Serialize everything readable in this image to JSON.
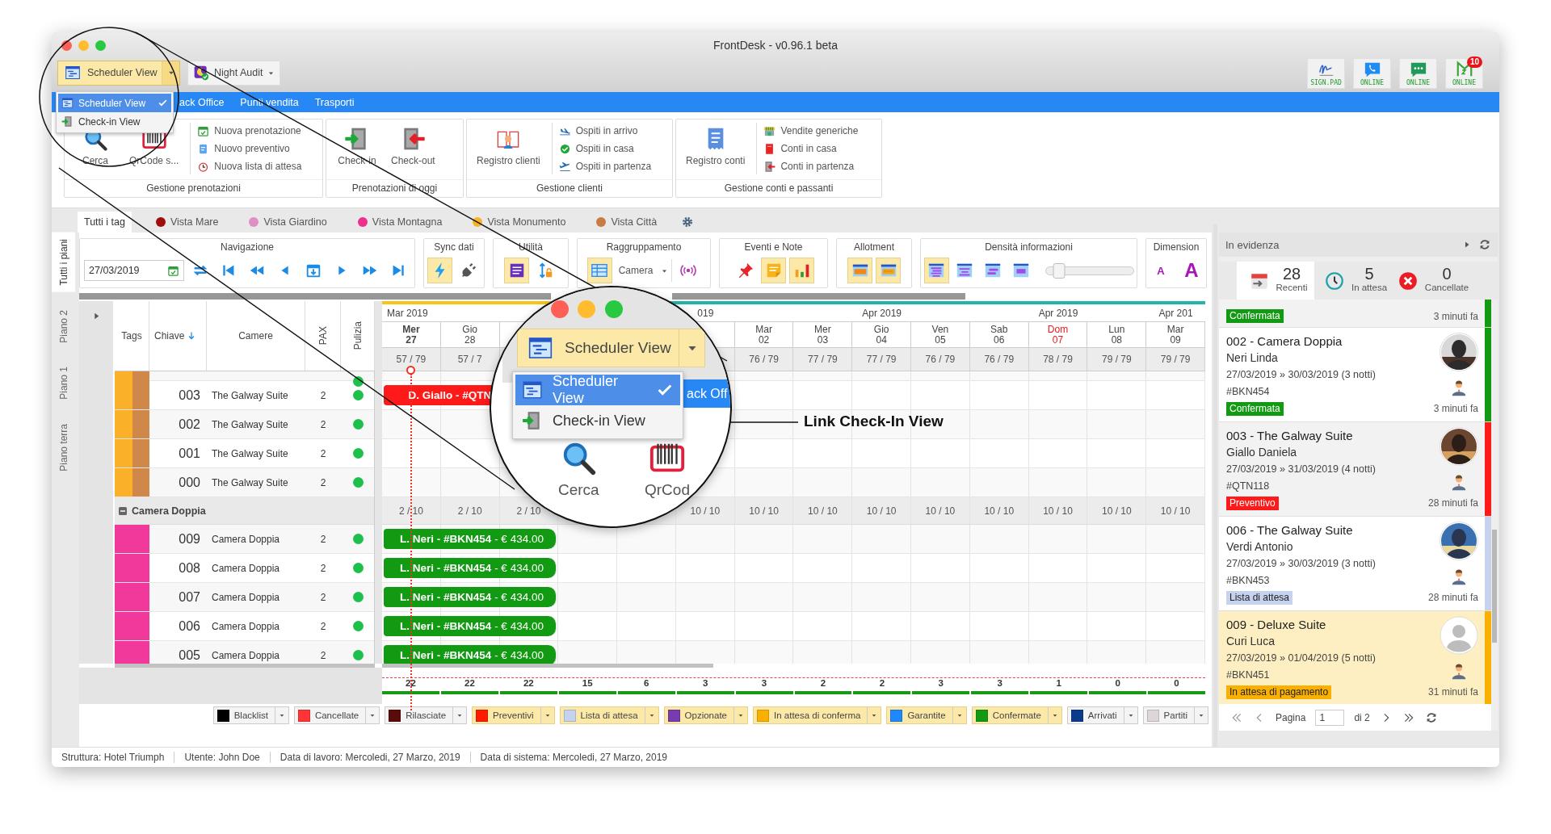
{
  "window": {
    "title": "FrontDesk - v0.96.1 beta"
  },
  "view_switcher": {
    "label": "Scheduler View",
    "expanded": true,
    "menu": [
      {
        "label": "Scheduler View",
        "selected": true
      },
      {
        "label": "Check-in View",
        "selected": false
      }
    ]
  },
  "night_audit": {
    "label": "Night Audit"
  },
  "devices": [
    {
      "label": "SIGN.PAD"
    },
    {
      "label": "ONLINE"
    },
    {
      "label": "ONLINE"
    },
    {
      "label": "ONLINE",
      "badge": "10"
    }
  ],
  "menu_bar": [
    "ack Office",
    "Punti vendita",
    "Trasporti"
  ],
  "ribbon": [
    {
      "title": "Gestione prenotazioni",
      "large": [
        "Cerca",
        "QrCode s..."
      ],
      "small": [
        "Nuova prenotazione",
        "Nuovo preventivo",
        "Nuova lista di attesa"
      ]
    },
    {
      "title": "Prenotazioni di oggi",
      "large": [
        "Check-in",
        "Check-out"
      ]
    },
    {
      "title": "Gestione clienti",
      "large": [
        "Registro clienti"
      ],
      "small": [
        "Ospiti in arrivo",
        "Ospiti in casa",
        "Ospiti in partenza"
      ]
    },
    {
      "title": "Gestione conti e passanti",
      "large": [
        "Registro conti"
      ],
      "small": [
        "Vendite generiche",
        "Conti in casa",
        "Conti in partenza"
      ]
    }
  ],
  "tag_filters": [
    {
      "label": "Tutti i tag",
      "selected": true
    },
    {
      "label": "Vista Mare",
      "color": "#a00d0d",
      "selected": false
    },
    {
      "label": "Vista Giardino",
      "color": "#e08fc4",
      "selected": false
    },
    {
      "label": "Vista Montagna",
      "color": "#ee2f8c",
      "selected": false
    },
    {
      "label": "Vista Monumento",
      "color": "#f7b324",
      "selected": false
    },
    {
      "label": "Vista Città",
      "color": "#c97b44",
      "selected": false
    }
  ],
  "floor_tabs": [
    {
      "label": "Tutti i piani",
      "selected": true
    },
    {
      "label": "Piano 2",
      "selected": false
    },
    {
      "label": "Piano 1",
      "selected": false
    },
    {
      "label": "Piano terra",
      "selected": false
    }
  ],
  "toolbar": [
    {
      "title": "Navigazione",
      "items": [
        {
          "kind": "date",
          "value": "27/03/2019"
        },
        {
          "kind": "button",
          "active": false
        },
        {
          "kind": "button",
          "active": false
        },
        {
          "kind": "button",
          "active": false
        },
        {
          "kind": "button",
          "active": false
        },
        {
          "kind": "button",
          "active": false
        },
        {
          "kind": "button",
          "active": false
        },
        {
          "kind": "button",
          "active": false
        },
        {
          "kind": "button",
          "active": false
        }
      ]
    },
    {
      "title": "Sync dati",
      "items": [
        {
          "kind": "button",
          "active": true
        },
        {
          "kind": "button",
          "active": false
        }
      ]
    },
    {
      "title": "Utilità",
      "items": [
        {
          "kind": "button",
          "active": true
        },
        {
          "kind": "button",
          "active": false
        }
      ]
    },
    {
      "title": "Raggruppamento",
      "items": [
        {
          "kind": "button",
          "active": true
        },
        {
          "kind": "select",
          "value": "Camera"
        },
        {
          "kind": "button",
          "active": false
        }
      ]
    },
    {
      "title": "Eventi e Note",
      "items": [
        {
          "kind": "button",
          "active": false
        },
        {
          "kind": "button",
          "active": true
        },
        {
          "kind": "button",
          "active": true
        }
      ]
    },
    {
      "title": "Allotment",
      "items": [
        {
          "kind": "button",
          "active": true
        },
        {
          "kind": "button",
          "active": true
        }
      ]
    },
    {
      "title": "Densità informazioni",
      "items": [
        {
          "kind": "button",
          "active": true
        },
        {
          "kind": "button",
          "active": false
        },
        {
          "kind": "button",
          "active": false
        },
        {
          "kind": "button",
          "active": false
        },
        {
          "kind": "slider",
          "level": 0.15
        }
      ]
    },
    {
      "title": "Dimension",
      "items": [
        {
          "kind": "text_button",
          "text": "A"
        },
        {
          "kind": "text_button",
          "text": "A"
        }
      ]
    }
  ],
  "scheduler": {
    "columns": [
      {
        "label": "Tags",
        "sorted": false
      },
      {
        "label": "Chiave",
        "sorted": true
      },
      {
        "label": "Camere",
        "sorted": false
      },
      {
        "label": "PAX",
        "sorted": false
      },
      {
        "label": "Pulizia",
        "sorted": false
      }
    ],
    "days": [
      {
        "kind": "day",
        "month": "Mar 2019",
        "weekday": "Mer",
        "date": "27",
        "avail": "57 / 79",
        "group_avail": "2 / 10",
        "holiday": false,
        "today": true,
        "color": "#f5c518"
      },
      {
        "kind": "day",
        "weekday": "Gio",
        "date": "28",
        "avail": "57 / 7",
        "group_avail": "2 / 10",
        "holiday": false,
        "today": false,
        "color": "#f5c518"
      },
      {
        "kind": "covered",
        "group_avail": "2 / 10",
        "color": "#f5c518"
      },
      {
        "kind": "covered"
      },
      {
        "kind": "covered",
        "color": "#1fb5a8"
      },
      {
        "kind": "covered",
        "month": "019",
        "group_avail": "10 / 10",
        "color": "#1fb5a8"
      },
      {
        "kind": "day",
        "weekday": "Mar",
        "date": "02",
        "avail": "76 / 79",
        "group_avail": "10 / 10",
        "holiday": false,
        "today": false,
        "color": "#1fb5a8"
      },
      {
        "kind": "day",
        "weekday": "Mer",
        "date": "03",
        "avail": "77 / 79",
        "group_avail": "10 / 10",
        "holiday": false,
        "today": false,
        "color": "#1fb5a8"
      },
      {
        "kind": "day",
        "month": "Apr 2019",
        "weekday": "Gio",
        "date": "04",
        "avail": "77 / 79",
        "group_avail": "10 / 10",
        "holiday": false,
        "today": false,
        "color": "#1fb5a8"
      },
      {
        "kind": "day",
        "weekday": "Ven",
        "date": "05",
        "avail": "76 / 79",
        "group_avail": "10 / 10",
        "holiday": false,
        "today": false,
        "color": "#1fb5a8"
      },
      {
        "kind": "day",
        "weekday": "Sab",
        "date": "06",
        "avail": "76 / 79",
        "group_avail": "10 / 10",
        "holiday": false,
        "today": false,
        "color": "#1fb5a8"
      },
      {
        "kind": "day",
        "month": "Apr 2019",
        "weekday": "Dom",
        "date": "07",
        "avail": "78 / 79",
        "group_avail": "10 / 10",
        "holiday": true,
        "today": false,
        "color": "#1fb5a8"
      },
      {
        "kind": "day",
        "weekday": "Lun",
        "date": "08",
        "avail": "79 / 79",
        "group_avail": "10 / 10",
        "holiday": false,
        "today": false,
        "color": "#1fb5a8"
      },
      {
        "kind": "day",
        "month": "Apr 201",
        "weekday": "Mar",
        "date": "09",
        "avail": "79 / 79",
        "group_avail": "10 / 10",
        "holiday": false,
        "today": false,
        "color": "#1fb5a8"
      }
    ],
    "rows": [
      {
        "kind": "partial",
        "tags": [
          {
            "color": "#fbb02a"
          },
          {
            "color": "#d0884a"
          }
        ],
        "clean": true
      },
      {
        "kind": "room",
        "key": "003",
        "name": "The Galway Suite",
        "pax": "2",
        "clean": true,
        "tags": [
          {
            "color": "#fbb02a"
          },
          {
            "color": "#d0884a"
          }
        ],
        "booking": {
          "label": "**D. Giallo - #QTN**",
          "color": "#ff1a1a"
        }
      },
      {
        "kind": "room",
        "key": "002",
        "name": "The Galway Suite",
        "pax": "2",
        "clean": true,
        "tags": [
          {
            "color": "#fbb02a"
          },
          {
            "color": "#d0884a"
          }
        ]
      },
      {
        "kind": "room",
        "key": "001",
        "name": "The Galway Suite",
        "pax": "2",
        "clean": true,
        "tags": [
          {
            "color": "#fbb02a"
          },
          {
            "color": "#d0884a"
          }
        ]
      },
      {
        "kind": "room",
        "key": "000",
        "name": "The Galway Suite",
        "pax": "2",
        "clean": true,
        "tags": [
          {
            "color": "#fbb02a"
          },
          {
            "color": "#d0884a"
          }
        ]
      },
      {
        "kind": "group",
        "label": "Camera Doppia",
        "expanded": true
      },
      {
        "kind": "room",
        "key": "009",
        "name": "Camera Doppia",
        "pax": "2",
        "clean": true,
        "tags": [
          {
            "color": "#f0399a"
          }
        ],
        "booking": {
          "label": "**L. Neri - #BKN454** - € 434.00",
          "color": "#139a13"
        }
      },
      {
        "kind": "room",
        "key": "008",
        "name": "Camera Doppia",
        "pax": "2",
        "clean": true,
        "tags": [
          {
            "color": "#f0399a"
          }
        ],
        "booking": {
          "label": "**L. Neri - #BKN454** - € 434.00",
          "color": "#139a13"
        }
      },
      {
        "kind": "room",
        "key": "007",
        "name": "Camera Doppia",
        "pax": "2",
        "clean": true,
        "tags": [
          {
            "color": "#f0399a"
          }
        ],
        "booking": {
          "label": "**L. Neri - #BKN454** - € 434.00",
          "color": "#139a13"
        }
      },
      {
        "kind": "room",
        "key": "006",
        "name": "Camera Doppia",
        "pax": "2",
        "clean": true,
        "tags": [
          {
            "color": "#f0399a"
          }
        ],
        "booking": {
          "label": "**L. Neri - #BKN454** - € 434.00",
          "color": "#139a13"
        }
      },
      {
        "kind": "room",
        "key": "005",
        "name": "Camera Doppia",
        "pax": "2",
        "clean": true,
        "tags": [
          {
            "color": "#f0399a"
          }
        ],
        "booking": {
          "label": "**L. Neri - #BKN454** - € 434.00",
          "color": "#139a13"
        }
      }
    ],
    "totals": [
      {
        "value": "22"
      },
      {
        "value": "22"
      },
      {
        "value": "22"
      },
      {
        "value": "15"
      },
      {
        "value": "6"
      },
      {
        "value": "3"
      },
      {
        "value": "3"
      },
      {
        "value": "2"
      },
      {
        "value": "2"
      },
      {
        "value": "3"
      },
      {
        "value": "3"
      },
      {
        "value": "1"
      },
      {
        "value": "0"
      },
      {
        "value": "0"
      }
    ]
  },
  "legend": [
    {
      "label": "Blacklist",
      "color": "#000000",
      "active": false
    },
    {
      "label": "Cancellate",
      "color": "#ff3535",
      "active": false
    },
    {
      "label": "Rilasciate",
      "color": "#5c0b0b",
      "active": false
    },
    {
      "label": "Preventivi",
      "color": "#ff1a00",
      "active": true
    },
    {
      "label": "Lista di attesa",
      "color": "#c5d3ee",
      "active": true
    },
    {
      "label": "Opzionate",
      "color": "#7b3bb0",
      "active": true
    },
    {
      "label": "In attesa di conferma",
      "color": "#fab000",
      "active": true
    },
    {
      "label": "Garantite",
      "color": "#1e88ff",
      "active": true
    },
    {
      "label": "Confermate",
      "color": "#139a13",
      "active": true
    },
    {
      "label": "Arrivati",
      "color": "#0b3a8c",
      "active": false
    },
    {
      "label": "Partiti",
      "color": "#dcd6d6",
      "active": false
    }
  ],
  "status_bar": [
    "Struttura: Hotel Triumph",
    "Utente: John Doe",
    "Data di lavoro: Mercoledi, 27 Marzo, 2019",
    "Data di sistema: Mercoledi, 27 Marzo, 2019"
  ],
  "highlights": {
    "title": "In evidenza",
    "tabs": [
      {
        "count": "28",
        "label": "Recenti",
        "selected": true
      },
      {
        "count": "5",
        "label": "In attesa",
        "selected": false
      },
      {
        "count": "0",
        "label": "Cancellate",
        "selected": false
      }
    ],
    "cards": [
      {
        "kind": "partial",
        "status": "Confermata",
        "color": "#139a13",
        "time": "3 minuti fa",
        "selected": false
      },
      {
        "kind": "full",
        "title": "002 - Camera Doppia",
        "guest": "Neri Linda",
        "dates": "27/03/2019 » 30/03/2019 (3 notti)",
        "code": "#BKN454",
        "status": "Confermata",
        "color": "#139a13",
        "time": "3 minuti fa",
        "photo": true,
        "selected": false
      },
      {
        "kind": "full",
        "title": "003 - The Galway Suite",
        "guest": "Giallo Daniela",
        "dates": "27/03/2019 » 31/03/2019 (4 notti)",
        "code": "#QTN118",
        "status": "Preventivo",
        "color": "#ff1a1a",
        "time": "28 minuti fa",
        "photo": true,
        "selected": false
      },
      {
        "kind": "full",
        "title": "006 - The Galway Suite",
        "guest": "Verdi Antonio",
        "dates": "27/03/2019 » 30/03/2019 (3 notti)",
        "code": "#BKN453",
        "status": "Lista di attesa",
        "color": "#c5d3ee",
        "time": "28 minuti fa",
        "photo": true,
        "selected": false
      },
      {
        "kind": "full",
        "title": "009 - Deluxe Suite",
        "guest": "Curi Luca",
        "dates": "27/03/2019 » 01/04/2019 (5 notti)",
        "code": "#BKN451",
        "status": "In attesa di pagamento",
        "color": "#fab000",
        "time": "31 minuti fa",
        "photo": false,
        "selected": true
      }
    ],
    "pager": {
      "label": "Pagina",
      "page": "1",
      "of": "di 2"
    }
  },
  "callout": {
    "button": "Scheduler View",
    "menu": [
      {
        "label": "Scheduler View",
        "selected": true
      },
      {
        "label": "Check-in View",
        "selected": false
      }
    ],
    "menu_bar_text": "ack Off",
    "tools": [
      "Cerca",
      "QrCod"
    ],
    "caption": "Link Check-In View"
  }
}
